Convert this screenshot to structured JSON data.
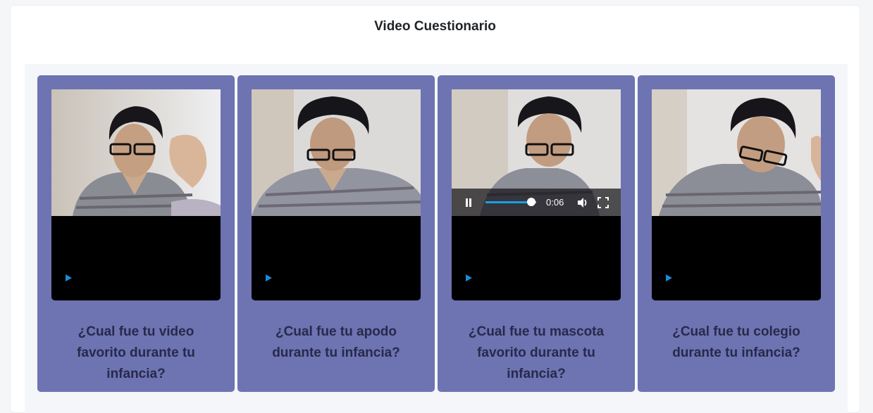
{
  "page": {
    "title": "Video Cuestionario"
  },
  "colors": {
    "card_background": "#6e73b2",
    "video_background": "#000000",
    "progress_accent": "#19a0e6",
    "question_text": "#262a4a"
  },
  "cards": [
    {
      "question": "¿Cual fue tu video favorito durante tu infancia?",
      "controls_visible": false,
      "playing": false
    },
    {
      "question": "¿Cual fue tu apodo durante tu infancia?",
      "controls_visible": false,
      "playing": false
    },
    {
      "question": "¿Cual fue tu mascota favorito durante tu infancia?",
      "controls_visible": true,
      "playing": true,
      "time": "0:06",
      "progress": 0.9
    },
    {
      "question": "¿Cual fue tu colegio durante tu infancia?",
      "controls_visible": false,
      "playing": false
    }
  ],
  "icons": [
    "play-icon",
    "pause-icon",
    "volume-icon",
    "fullscreen-icon"
  ]
}
